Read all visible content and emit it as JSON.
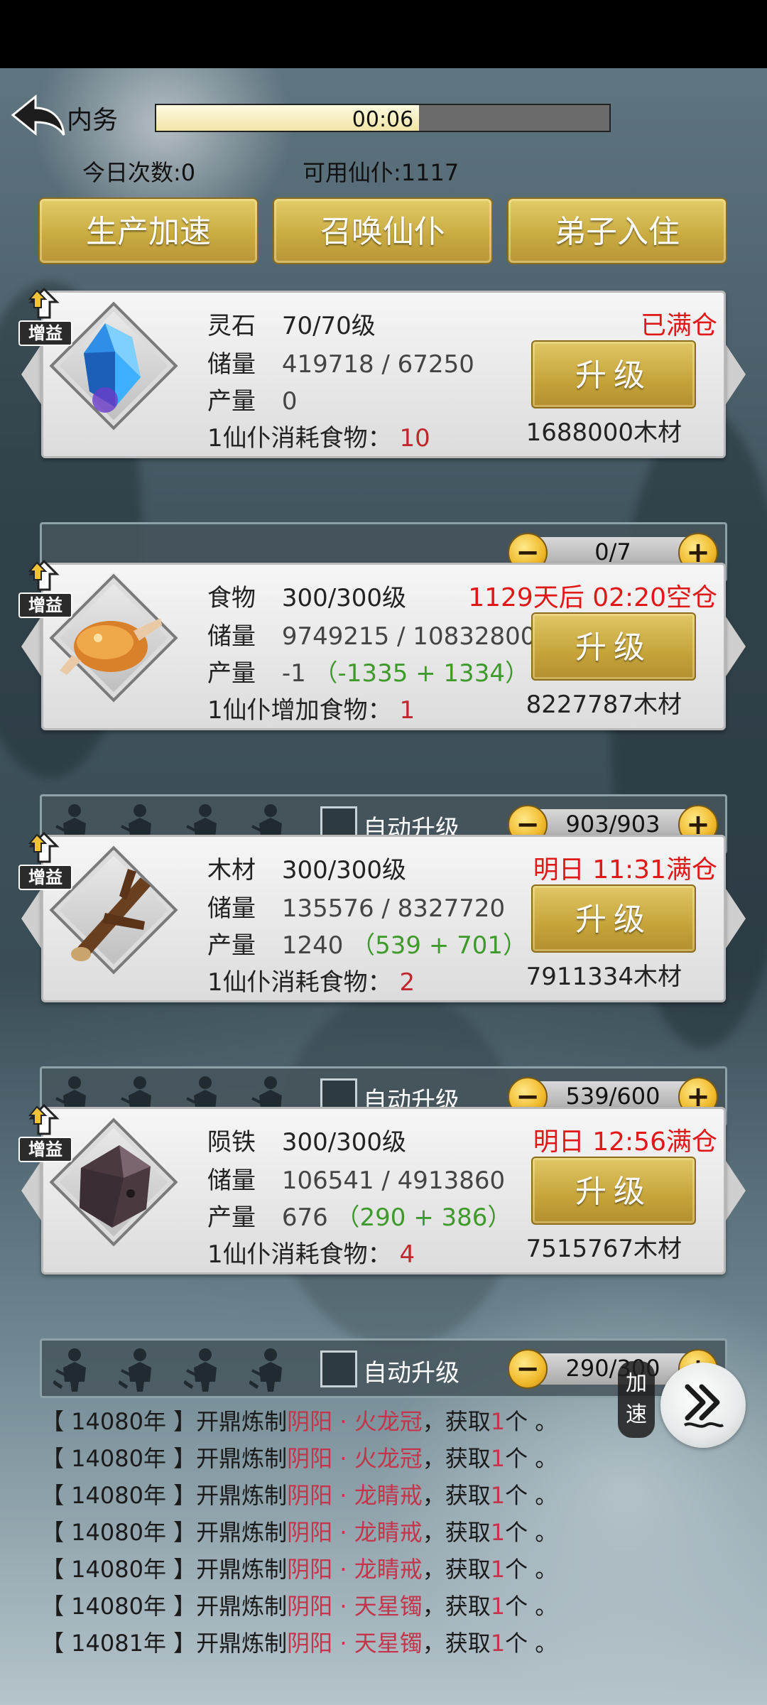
{
  "header": {
    "title": "内务",
    "timer": "00:06",
    "timer_progress": 0.58,
    "today_count": "今日次数:0",
    "available_servants": "可用仙仆:1117"
  },
  "top_buttons": [
    "生产加速",
    "召唤仙仆",
    "弟子入住"
  ],
  "buff_label": "增益",
  "upgrade_label": "升级",
  "auto_upgrade_label": "自动升级",
  "resources": [
    {
      "name": "灵石",
      "level": "70/70级",
      "storage_label": "储量",
      "storage": "419718 / 67250",
      "output_label": "产量",
      "output": "0",
      "output_detail": "",
      "cost_label": "1仙仆消耗食物：",
      "cost_value": "10",
      "status": "已满仓",
      "wood": "1688000木材",
      "count": "0/7",
      "has_workers": false,
      "icon": "spirit-stone-icon"
    },
    {
      "name": "食物",
      "level": "300/300级",
      "storage_label": "储量",
      "storage": "9749215 / 10832800",
      "output_label": "产量",
      "output": "-1",
      "output_detail": "（-1335 + 1334）",
      "cost_label": "1仙仆增加食物：",
      "cost_value": "1",
      "status": "1129天后 02:20空仓",
      "wood": "8227787木材",
      "count": "903/903",
      "has_workers": true,
      "icon": "roast-chicken-icon"
    },
    {
      "name": "木材",
      "level": "300/300级",
      "storage_label": "储量",
      "storage": "135576 / 8327720",
      "output_label": "产量",
      "output": "1240",
      "output_detail": "（539 + 701）",
      "cost_label": "1仙仆消耗食物：",
      "cost_value": "2",
      "status": "明日 11:31满仓",
      "wood": "7911334木材",
      "count": "539/600",
      "has_workers": true,
      "icon": "wood-log-icon"
    },
    {
      "name": "陨铁",
      "level": "300/300级",
      "storage_label": "储量",
      "storage": "106541 / 4913860",
      "output_label": "产量",
      "output": "676",
      "output_detail": "（290 + 386）",
      "cost_label": "1仙仆消耗食物：",
      "cost_value": "4",
      "status": "明日 12:56满仓",
      "wood": "7515767木材",
      "count": "290/300",
      "has_workers": true,
      "icon": "meteorite-iron-icon"
    }
  ],
  "speed_label_1": "加",
  "speed_label_2": "速",
  "log": [
    {
      "year": "【 14080年 】",
      "action": "开鼎炼制",
      "quality": "阴阳 · 火龙冠",
      "tail": "，获取",
      "num": "1",
      "unit": "个 。"
    },
    {
      "year": "【 14080年 】",
      "action": "开鼎炼制",
      "quality": "阴阳 · 火龙冠",
      "tail": "，获取",
      "num": "1",
      "unit": "个 。"
    },
    {
      "year": "【 14080年 】",
      "action": "开鼎炼制",
      "quality": "阴阳 · 龙睛戒",
      "tail": "，获取",
      "num": "1",
      "unit": "个 。"
    },
    {
      "year": "【 14080年 】",
      "action": "开鼎炼制",
      "quality": "阴阳 · 龙睛戒",
      "tail": "，获取",
      "num": "1",
      "unit": "个 。"
    },
    {
      "year": "【 14080年 】",
      "action": "开鼎炼制",
      "quality": "阴阳 · 龙睛戒",
      "tail": "，获取",
      "num": "1",
      "unit": "个 。"
    },
    {
      "year": "【 14080年 】",
      "action": "开鼎炼制",
      "quality": "阴阳 · 天星镯",
      "tail": "，获取",
      "num": "1",
      "unit": "个 。"
    },
    {
      "year": "【 14081年 】",
      "action": "开鼎炼制",
      "quality": "阴阳 · 天星镯",
      "tail": "，获取",
      "num": "1",
      "unit": "个 。"
    }
  ]
}
